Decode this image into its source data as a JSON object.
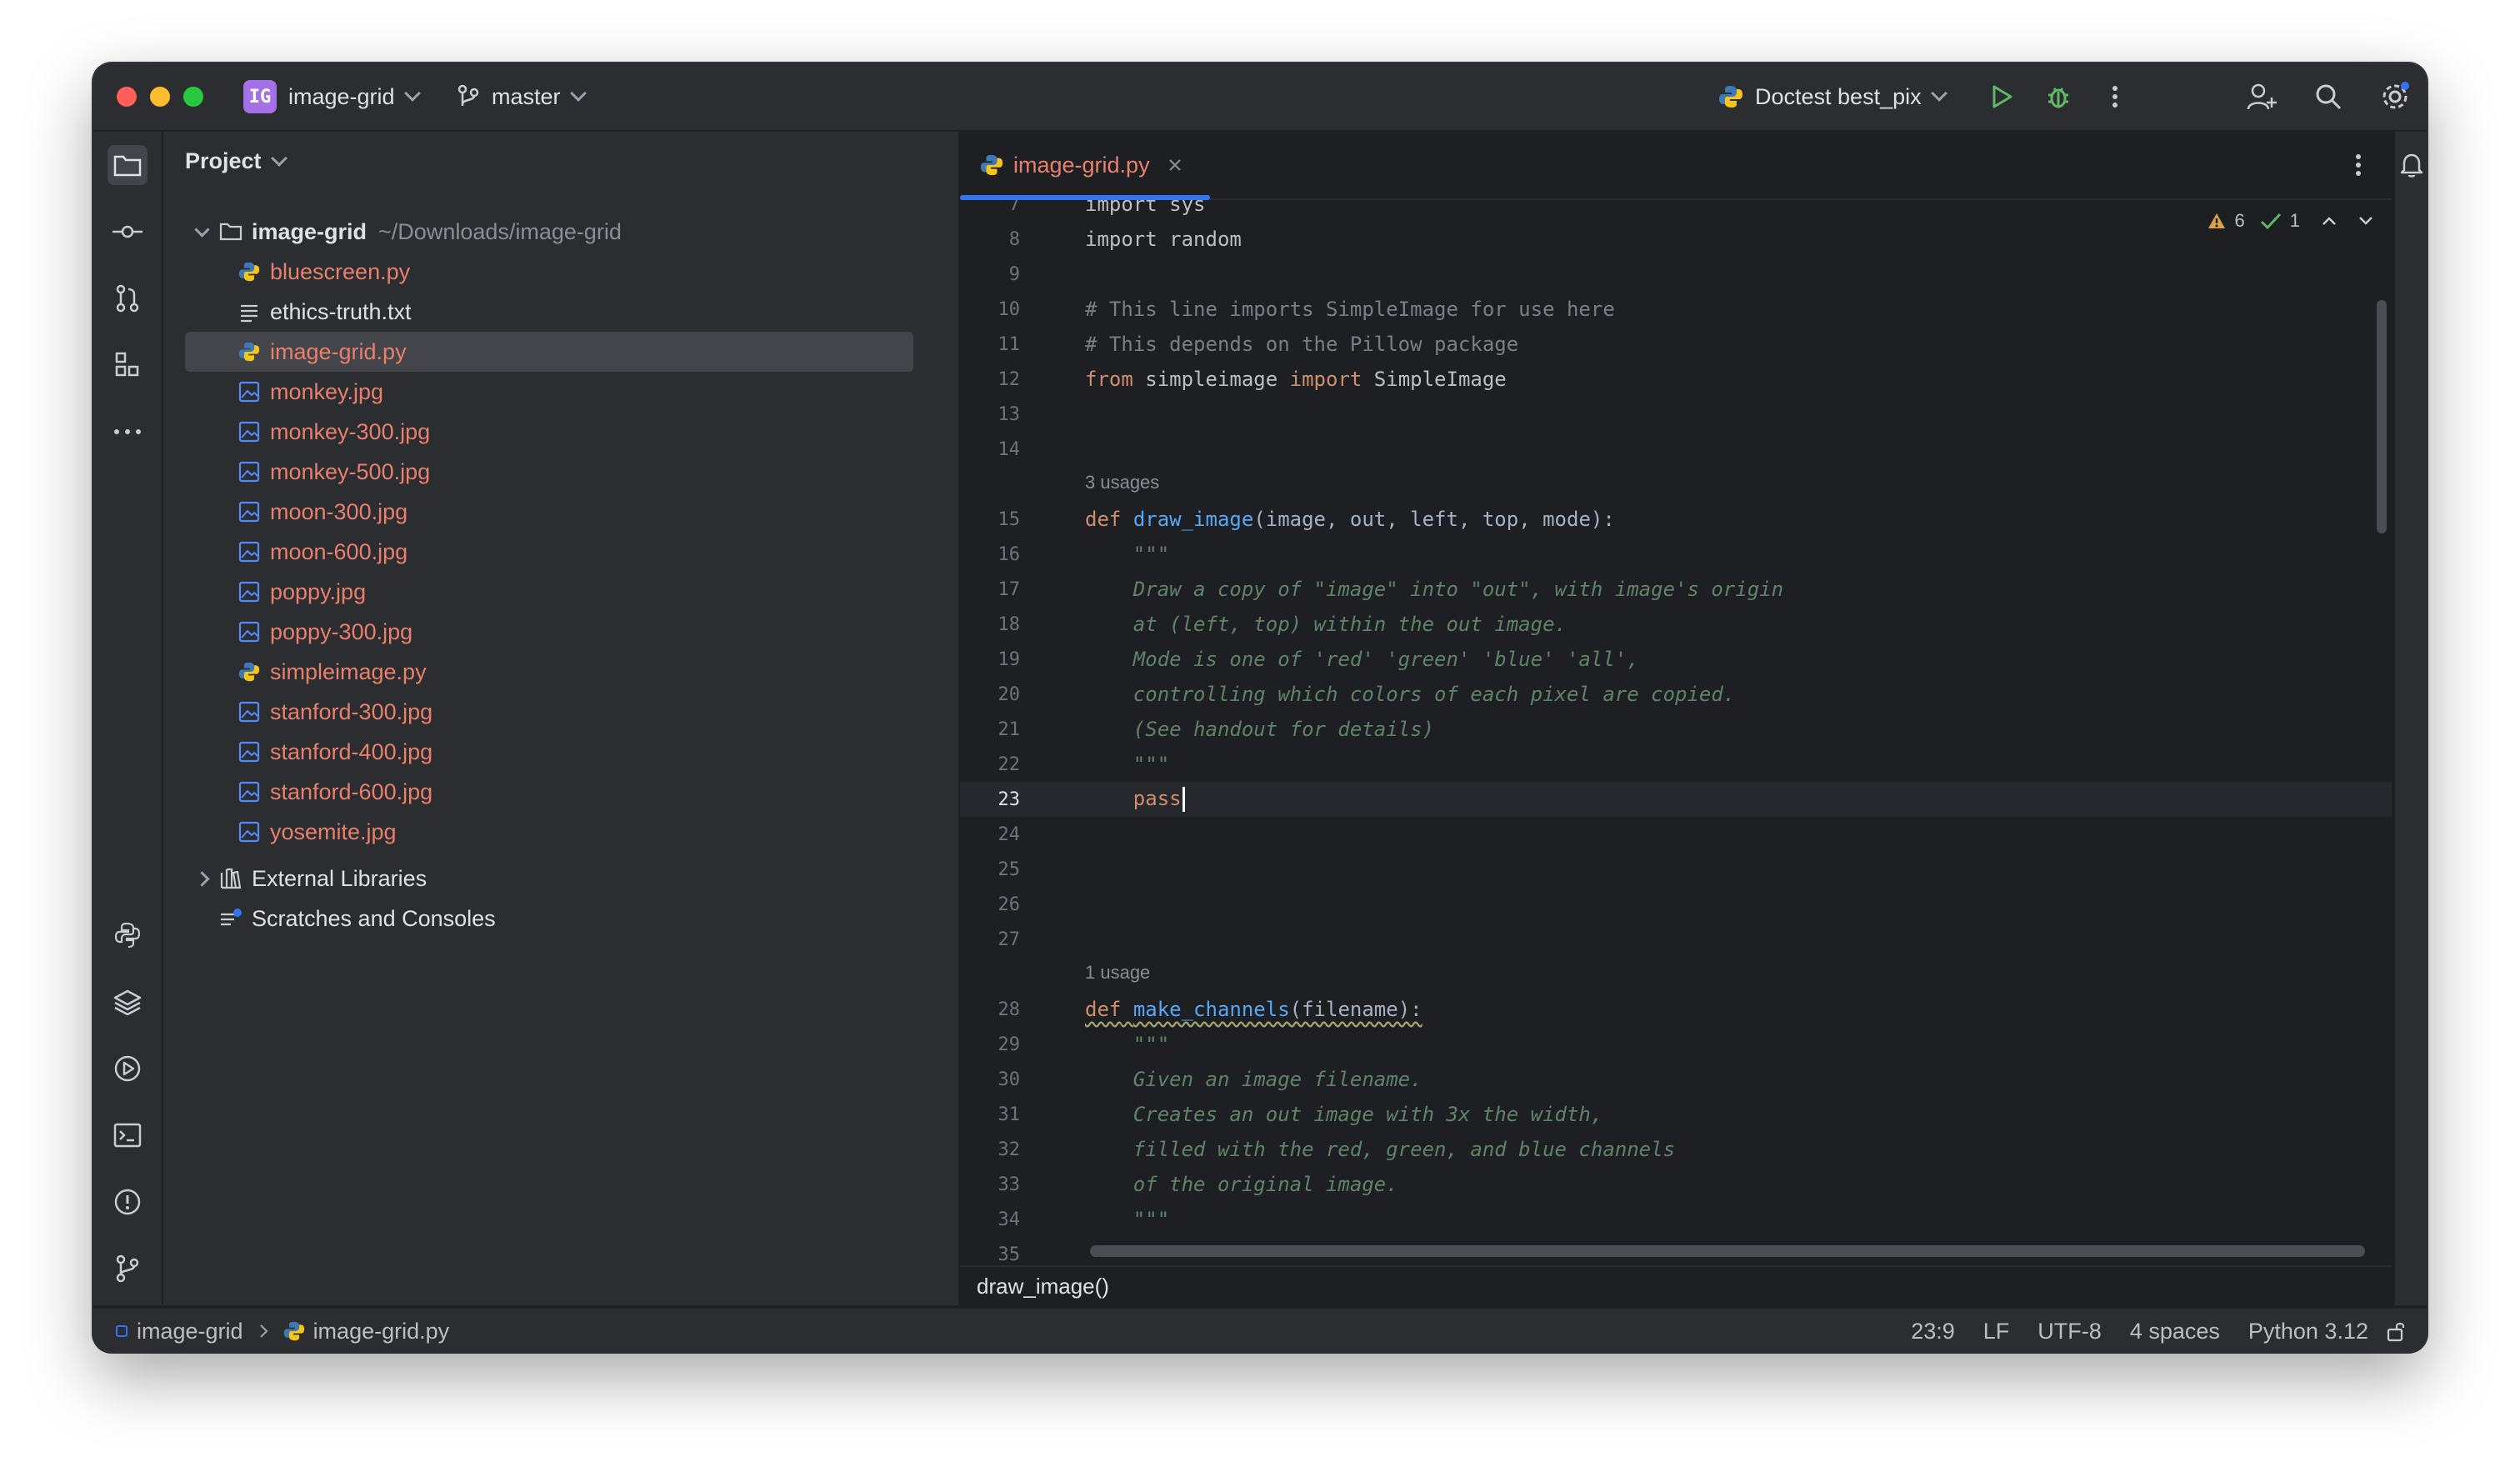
{
  "titlebar": {
    "project_badge": "IG",
    "project_name": "image-grid",
    "branch": "master",
    "run_config": "Doctest best_pix"
  },
  "project_panel": {
    "title": "Project",
    "root_name": "image-grid",
    "root_path": "~/Downloads/image-grid",
    "files": [
      {
        "name": "bluescreen.py",
        "type": "python"
      },
      {
        "name": "ethics-truth.txt",
        "type": "text"
      },
      {
        "name": "image-grid.py",
        "type": "python"
      },
      {
        "name": "monkey.jpg",
        "type": "image"
      },
      {
        "name": "monkey-300.jpg",
        "type": "image"
      },
      {
        "name": "monkey-500.jpg",
        "type": "image"
      },
      {
        "name": "moon-300.jpg",
        "type": "image"
      },
      {
        "name": "moon-600.jpg",
        "type": "image"
      },
      {
        "name": "poppy.jpg",
        "type": "image"
      },
      {
        "name": "poppy-300.jpg",
        "type": "image"
      },
      {
        "name": "simpleimage.py",
        "type": "python"
      },
      {
        "name": "stanford-300.jpg",
        "type": "image"
      },
      {
        "name": "stanford-400.jpg",
        "type": "image"
      },
      {
        "name": "stanford-600.jpg",
        "type": "image"
      },
      {
        "name": "yosemite.jpg",
        "type": "image"
      }
    ],
    "external_libraries": "External Libraries",
    "scratches": "Scratches and Consoles"
  },
  "editor": {
    "tab_label": "image-grid.py",
    "inspections": {
      "warnings": "6",
      "checks": "1"
    },
    "usages_1": "3 usages",
    "usages_2": "1 usage",
    "lines": {
      "l7": "import sys",
      "l8": "import random",
      "l10": "# This line imports SimpleImage for use here",
      "l11": "# This depends on the Pillow package",
      "l12_kw": "from",
      "l12_a": " simpleimage ",
      "l12_kw2": "import",
      "l12_b": " SimpleImage",
      "l15_kw": "def",
      "l15_fn": "draw_image",
      "l15_rest": "(image, out, left, top, mode):",
      "l16": "    \"\"\"",
      "l17": "    Draw a copy of \"image\" into \"out\", with image's origin",
      "l18": "    at (left, top) within the out image.",
      "l19": "    Mode is one of 'red' 'green' 'blue' 'all',",
      "l20": "    controlling which colors of each pixel are copied.",
      "l21": "    (See handout for details)",
      "l22": "    \"\"\"",
      "l23": "    pass",
      "l28_kw": "def",
      "l28_fn": "make_channels",
      "l28_rest": "(filename):",
      "l29": "    \"\"\"",
      "l30": "    Given an image filename.",
      "l31": "    Creates an out image with 3x the width,",
      "l32": "    filled with the red, green, and blue channels",
      "l33": "    of the original image.",
      "l34": "    \"\"\""
    },
    "breadcrumb": "draw_image()"
  },
  "statusbar": {
    "project": "image-grid",
    "file": "image-grid.py",
    "position": "23:9",
    "line_ending": "LF",
    "encoding": "UTF-8",
    "indent": "4 spaces",
    "interpreter": "Python 3.12"
  }
}
